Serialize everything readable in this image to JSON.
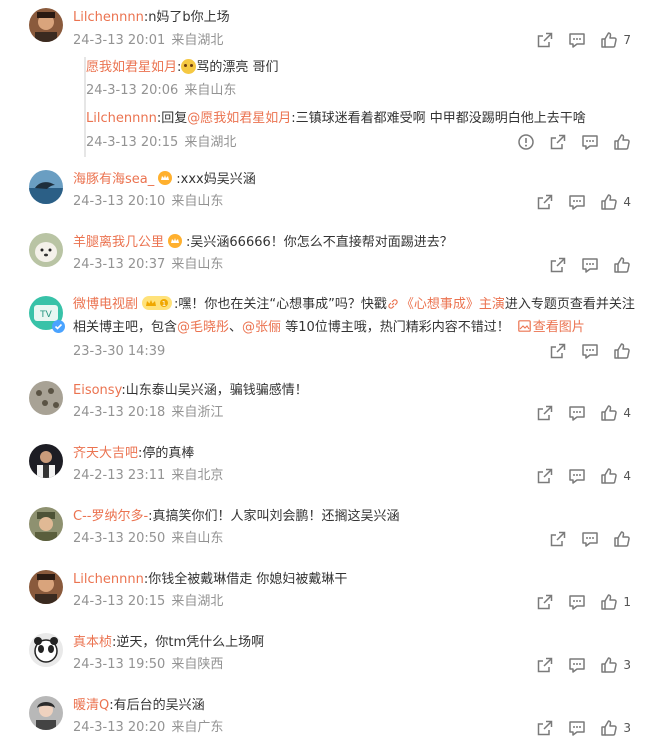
{
  "colors": {
    "accent": "#eb7350",
    "meta": "#939393",
    "text": "#333333"
  },
  "comments": [
    {
      "user": "Lilchennnn",
      "text": ":n妈了b你上场",
      "time": "24-3-13 20:01",
      "loc": "来自湖北",
      "likes": "7",
      "replies": [
        {
          "user": "愿我如君星如月",
          "text": "骂的漂亮 哥们",
          "time": "24-3-13 20:06",
          "loc": "来自山东"
        },
        {
          "user": "Lilchennnn",
          "prefix": ":回复",
          "at": "@愿我如君星如月",
          "text": ":三镇球迷看着都难受啊 中甲都没踢明白他上去干啥",
          "time": "24-3-13 20:15",
          "loc": "来自湖北"
        }
      ]
    },
    {
      "user": "海豚有海sea_",
      "text": ":xxx妈吴兴涵",
      "time": "24-3-13 20:10",
      "loc": "来自山东",
      "likes": "4"
    },
    {
      "user": "羊腿离我几公里",
      "text": ":吴兴涵66666！你怎么不直接帮对面踢进去？",
      "time": "24-3-13 20:37",
      "loc": "来自山东",
      "likes": ""
    },
    {
      "user": "微博电视剧",
      "text1": ":嘿！你也在关注“心想事成”吗？快戳",
      "link": "《心想事成》主演",
      "text2": "进入专题页查看并关注相关博主吧，包含",
      "at1": "@毛晓彤",
      "sep": "、",
      "at2": "@张俪",
      "text3": " 等10位博主哦，热门精彩内容不错过！",
      "img_link": "查看图片",
      "time": "23-3-30 14:39",
      "likes": ""
    },
    {
      "user": "Eisonsy",
      "text": ":山东泰山吴兴涵，骗钱骗感情！",
      "time": "24-3-13 20:18",
      "loc": "来自浙江",
      "likes": "4"
    },
    {
      "user": "齐天大吉吧",
      "text": ":停的真棒",
      "time": "24-2-13 23:11",
      "loc": "来自北京",
      "likes": "4"
    },
    {
      "user": "C--罗纳尔多-",
      "text": ":真搞笑你们！人家叫刘会鹏！还搁这吴兴涵",
      "time": "24-3-13 20:50",
      "loc": "来自山东",
      "likes": ""
    },
    {
      "user": "Lilchennnn",
      "text": ":你钱全被戴琳借走 你媳妇被戴琳干",
      "time": "24-3-13 20:15",
      "loc": "来自湖北",
      "likes": "1"
    },
    {
      "user": "真本桢",
      "text": ":逆天，你tm凭什么上场啊",
      "time": "24-3-13 19:50",
      "loc": "来自陕西",
      "likes": "3"
    },
    {
      "user": "暖清Q",
      "text": ":有后台的吴兴涵",
      "time": "24-3-13 20:20",
      "loc": "来自广东",
      "likes": "3"
    }
  ]
}
